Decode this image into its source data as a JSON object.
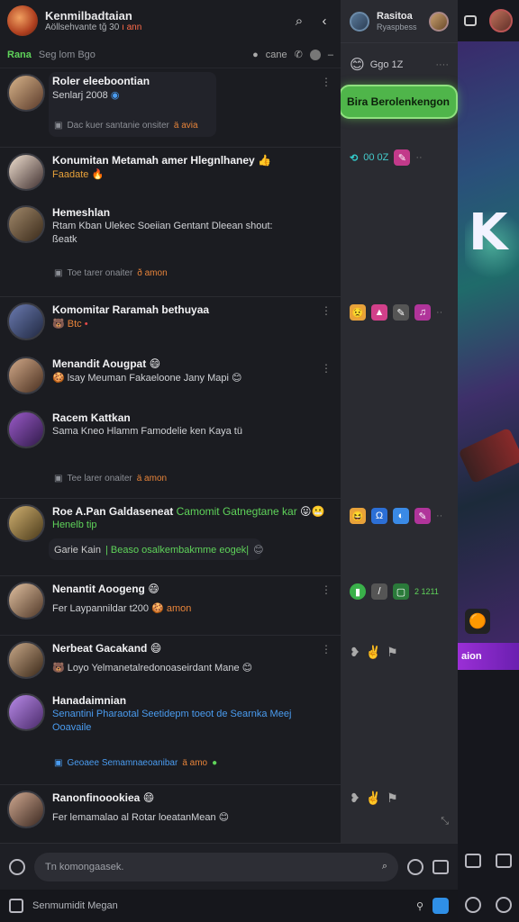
{
  "header": {
    "title": "Kenmilbadtaian",
    "subtitle": "Aöllsehvante tğ 30",
    "subtitle_red": "ı ann"
  },
  "subbar": {
    "green": "Rana",
    "muted": "Seg lom  Bgo",
    "right": "cane"
  },
  "chats": [
    {
      "name": "Roler eleeboontian",
      "text": "Senlarj 2008",
      "meta": "Dac kuer santanie onsiter",
      "meta_orange": "ä avia"
    },
    {
      "name": "Konumitan Metamah amer Hlegnlhaney",
      "text": "Faadate",
      "text_color": "orange"
    },
    {
      "name": "Hemeshlan",
      "text": "Rtam Kban Ulekec Soeiian Gentant Dleean  shout: ßeatk",
      "meta": "Toe tarer onaiter",
      "meta_orange": "ð amon"
    },
    {
      "name": "Komomitar Raramah bethuyaa",
      "text": "Btc"
    },
    {
      "name": "Menandit Aougpat",
      "text": "lsay Meuman Fakaeloone Jany Mapi"
    },
    {
      "name": "Racem Kattkan",
      "text": "Sama Kneo Hlamm Famodelie ken Kaya  tü",
      "meta": "Tee larer onaiter",
      "meta_orange": "ä amon"
    },
    {
      "name": "Roe A.Pan Galdaseneat",
      "name_green": "Camomit Gatnegtane kar",
      "text_green": "Henelb tip",
      "quote": "Garie Kain",
      "quote_green": "| Beaso osalkembakmme eogek|"
    },
    {
      "name": "Nenantit Aoogeng",
      "text": "Fer Laypannildar t200",
      "text_orange": "amon"
    },
    {
      "name": "Nerbeat Gacakand",
      "text": "Loyo Yelmanetalredonoaseirdant Mane"
    },
    {
      "name": "Hanadaimnian",
      "text_blue": "Senantini Pharaotal  Seetidepm toeot de Searnka Meej Ooavaile",
      "meta_blue": "Geoaee Semamnaeoanibar",
      "meta_orange": "ä amo"
    },
    {
      "name": "Ranonfinoookiea",
      "text": "Fer lemamalao al  Rotar loeatanMean"
    }
  ],
  "middle": {
    "title": "Rasitoa",
    "subtitle": "Ryaspbess",
    "row1": "Ggo 1Z",
    "green_button": "Bira Berolenkengon",
    "row2": "00 0Z",
    "row3_label": "2 1211"
  },
  "game": {
    "letter": "K",
    "banner": "aion"
  },
  "composer": {
    "placeholder": "Tn komongaasek."
  },
  "bottombar": {
    "label": "Senmumidit Megan"
  },
  "colors": {
    "accent_green": "#5fd35a",
    "accent_orange": "#e8843a",
    "accent_blue": "#4a9cf0"
  }
}
